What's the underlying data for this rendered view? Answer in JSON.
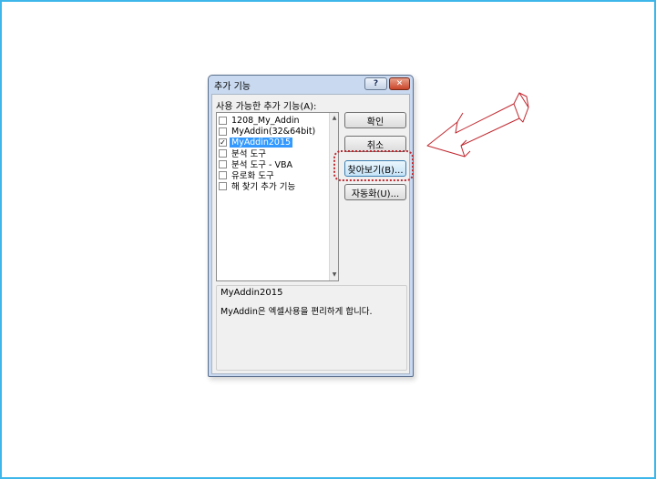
{
  "dialog": {
    "title": "추가 기능",
    "help_button": "?",
    "close_button": "✕"
  },
  "addins": {
    "label": "사용 가능한 추가 기능(A):",
    "items": [
      {
        "label": "1208_My_Addin",
        "checked": false,
        "selected": false
      },
      {
        "label": "MyAddin(32&64bit)",
        "checked": false,
        "selected": false
      },
      {
        "label": "MyAddin2015",
        "checked": true,
        "selected": true
      },
      {
        "label": "분석 도구",
        "checked": false,
        "selected": false
      },
      {
        "label": "분석 도구 - VBA",
        "checked": false,
        "selected": false
      },
      {
        "label": "유로화 도구",
        "checked": false,
        "selected": false
      },
      {
        "label": "해 찾기 추가 기능",
        "checked": false,
        "selected": false
      }
    ]
  },
  "buttons": {
    "ok": "확인",
    "cancel": "취소",
    "browse": "찾아보기(B)...",
    "automation": "자동화(U)..."
  },
  "description": {
    "title": "MyAddin2015",
    "text": "MyAddin은 엑셀사용을 편리하게 합니다."
  },
  "colors": {
    "frame_border": "#3fb6ea",
    "annotation_red": "#c0282f",
    "selection": "#3399ff"
  }
}
